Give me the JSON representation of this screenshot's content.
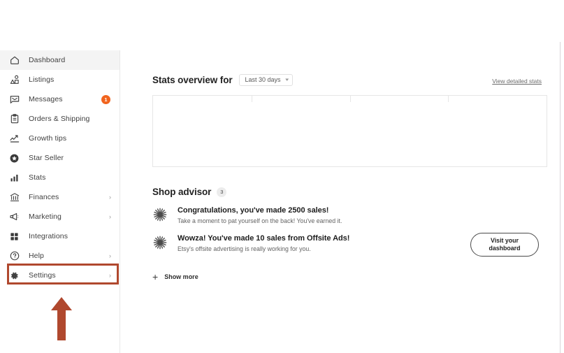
{
  "theme": {
    "accent_orange": "#f1641e",
    "annotation_red": "#b0482e",
    "active_bg": "#f4f4f4",
    "border": "#e6e6e6"
  },
  "sidebar": {
    "items": [
      {
        "label": "Dashboard",
        "icon": "home-icon",
        "active": true,
        "chevron": false,
        "badge": null
      },
      {
        "label": "Listings",
        "icon": "listings-icon",
        "active": false,
        "chevron": false,
        "badge": null
      },
      {
        "label": "Messages",
        "icon": "envelope-icon",
        "active": false,
        "chevron": false,
        "badge": "1"
      },
      {
        "label": "Orders & Shipping",
        "icon": "clipboard-icon",
        "active": false,
        "chevron": false,
        "badge": null
      },
      {
        "label": "Growth tips",
        "icon": "growth-tips-icon",
        "active": false,
        "chevron": false,
        "badge": null
      },
      {
        "label": "Star Seller",
        "icon": "star-badge-icon",
        "active": false,
        "chevron": false,
        "badge": null
      },
      {
        "label": "Stats",
        "icon": "bar-chart-icon",
        "active": false,
        "chevron": false,
        "badge": null
      },
      {
        "label": "Finances",
        "icon": "bank-icon",
        "active": false,
        "chevron": true,
        "badge": null
      },
      {
        "label": "Marketing",
        "icon": "megaphone-icon",
        "active": false,
        "chevron": true,
        "badge": null
      },
      {
        "label": "Integrations",
        "icon": "grid-icon",
        "active": false,
        "chevron": false,
        "badge": null
      },
      {
        "label": "Help",
        "icon": "question-icon",
        "active": false,
        "chevron": true,
        "badge": null
      },
      {
        "label": "Settings",
        "icon": "gear-icon",
        "active": false,
        "chevron": true,
        "badge": null
      }
    ],
    "chevron_glyph": "›"
  },
  "stats": {
    "title": "Stats overview for",
    "period": "Last 30 days",
    "period_caret": "▾",
    "detail_link": "View detailed stats",
    "columns": 4
  },
  "advisor": {
    "title": "Shop advisor",
    "badge": "3",
    "items": [
      {
        "icon": "sparkle-icon",
        "title": "Congratulations, you've made 2500 sales!",
        "subtitle": "Take a moment to pat yourself on the back! You've earned it."
      },
      {
        "icon": "sparkle-icon",
        "title": "Wowza! You've made 10 sales from Offsite Ads!",
        "subtitle": "Etsy's offsite advertising is really working for you."
      }
    ],
    "dashboard_button_line1": "Visit your",
    "dashboard_button_line2": "dashboard",
    "show_more_plus": "+",
    "show_more_label": "Show more"
  }
}
